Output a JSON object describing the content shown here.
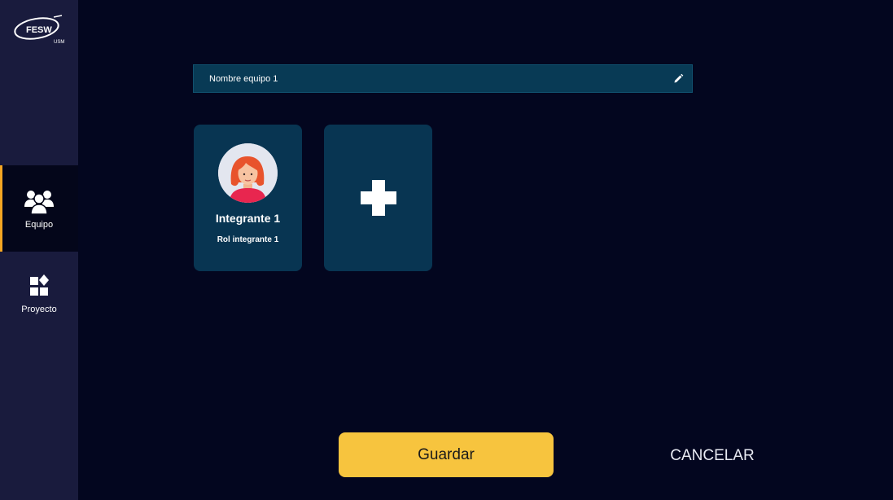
{
  "brand": {
    "logo_text": "FESW",
    "logo_subtext": "USM"
  },
  "sidebar": {
    "items": [
      {
        "label": "Equipo",
        "icon": "team-icon",
        "active": true
      },
      {
        "label": "Proyecto",
        "icon": "project-icon",
        "active": false
      }
    ]
  },
  "team": {
    "name": "Nombre equipo 1"
  },
  "members": [
    {
      "name": "Integrante 1",
      "role": "Rol integrante 1",
      "avatar": "female-avatar-icon"
    }
  ],
  "actions": {
    "save_label": "Guardar",
    "cancel_label": "CANCELAR"
  },
  "colors": {
    "background": "#03061f",
    "sidebar": "#191b3d",
    "card": "#083552",
    "accent": "#f7c43e",
    "active_indicator": "#f5a623"
  }
}
